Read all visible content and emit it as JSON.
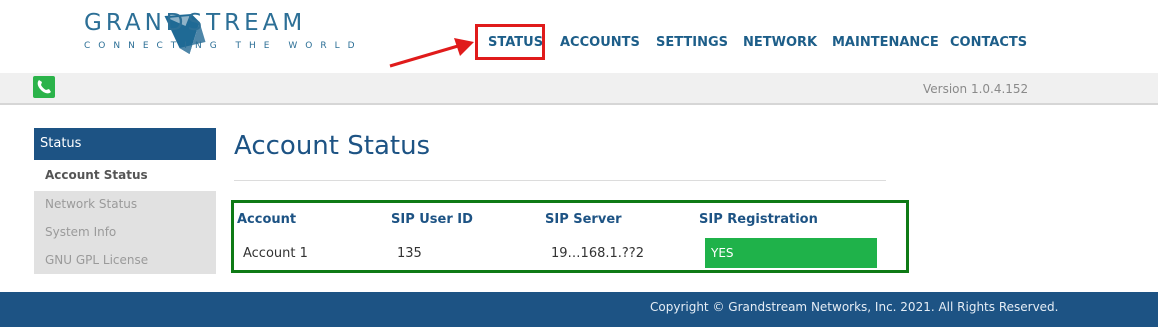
{
  "brand": {
    "name": "GRANDSTREAM",
    "tagline": "CONNECTING THE WORLD"
  },
  "nav": {
    "items": [
      "STATUS",
      "ACCOUNTS",
      "SETTINGS",
      "NETWORK",
      "MAINTENANCE",
      "CONTACTS"
    ]
  },
  "version_text": "Version 1.0.4.152",
  "sidebar": {
    "section": "Status",
    "items": [
      "Account Status",
      "Network Status",
      "System Info",
      "GNU GPL License"
    ]
  },
  "page_title": "Account Status",
  "table": {
    "headers": [
      "Account",
      "SIP User ID",
      "SIP Server",
      "SIP Registration"
    ],
    "rows": [
      {
        "account": "Account 1",
        "sip_user_id": "135",
        "sip_server": "19…168.1.??2",
        "sip_registration": "YES"
      }
    ]
  },
  "footer": {
    "copyright": "Copyright © Grandstream Networks, Inc. 2021. All Rights Reserved."
  },
  "colors": {
    "primary": "#1d5384",
    "success": "#1fb24a",
    "annotation_red": "#e01b1b",
    "annotation_green": "#0e7a15"
  }
}
